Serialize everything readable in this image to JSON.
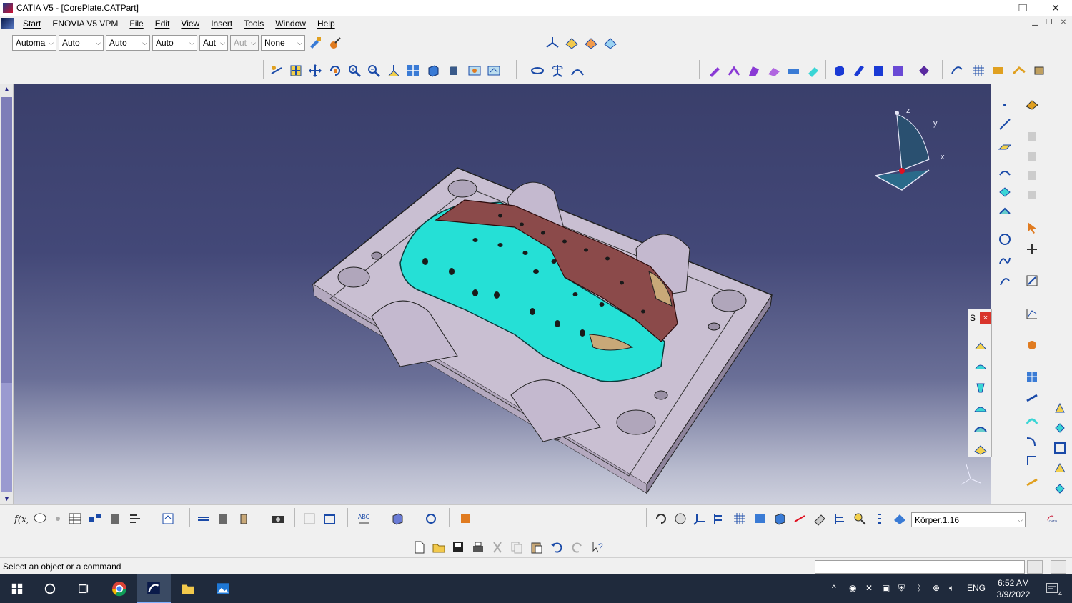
{
  "window": {
    "title": "CATIA V5 - [CorePlate.CATPart]",
    "min": "—",
    "max": "❐",
    "close": "✕"
  },
  "menu": {
    "items": [
      "Start",
      "ENOVIA V5 VPM",
      "File",
      "Edit",
      "View",
      "Insert",
      "Tools",
      "Window",
      "Help"
    ]
  },
  "graphic_properties": {
    "color": "Automa",
    "transparency": "Auto",
    "line_thickness": "Auto",
    "line_type": "Auto",
    "point_type": "Aut",
    "layer_disabled": "Aut",
    "rendering": "None"
  },
  "float_panel": {
    "title": "S",
    "close": "×"
  },
  "compass": {
    "x": "x",
    "y": "y",
    "z": "z"
  },
  "bottom": {
    "body_selector": "Körper.1.16",
    "catia_logo": "CATIA"
  },
  "status": {
    "message": "Select an object or a command",
    "command_input": ""
  },
  "taskbar": {
    "language": "ENG",
    "time": "6:52 AM",
    "date": "3/9/2022",
    "notifications": "4"
  },
  "colors": {
    "mold": "#c9bfd2",
    "car_cyan": "#25e0d6",
    "car_parting": "#8b4a4a",
    "viewport_top": "#3a3f6b"
  }
}
